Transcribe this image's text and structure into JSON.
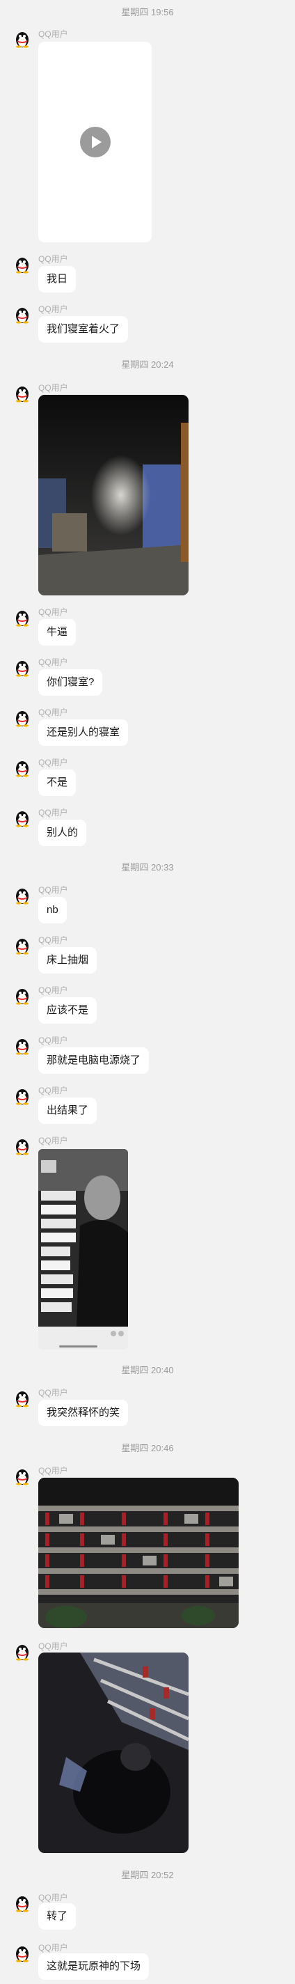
{
  "timestamps": [
    "星期四 19:56",
    "星期四 20:24",
    "星期四 20:33",
    "星期四 20:40",
    "星期四 20:46",
    "星期四 20:52"
  ],
  "sender_name": "QQ用户",
  "messages": {
    "m2": "我日",
    "m3": "我们寝室着火了",
    "m5": "牛逼",
    "m6": "你们寝室?",
    "m7": "还是别人的寝室",
    "m8": "不是",
    "m9": "别人的",
    "m10": "nb",
    "m11": "床上抽烟",
    "m12": "应该不是",
    "m13": "那就是电脑电源烧了",
    "m14": "出结果了",
    "m16": "我突然释怀的笑",
    "m19": "转了",
    "m20": "这就是玩原神的下场"
  },
  "icons": {
    "avatar": "qq-penguin-icon",
    "video": "play-icon"
  },
  "colors": {
    "background": "#f2f2f2",
    "bubble": "#ffffff",
    "timestamp": "#9a9a9a",
    "name": "#b0b0b0"
  }
}
